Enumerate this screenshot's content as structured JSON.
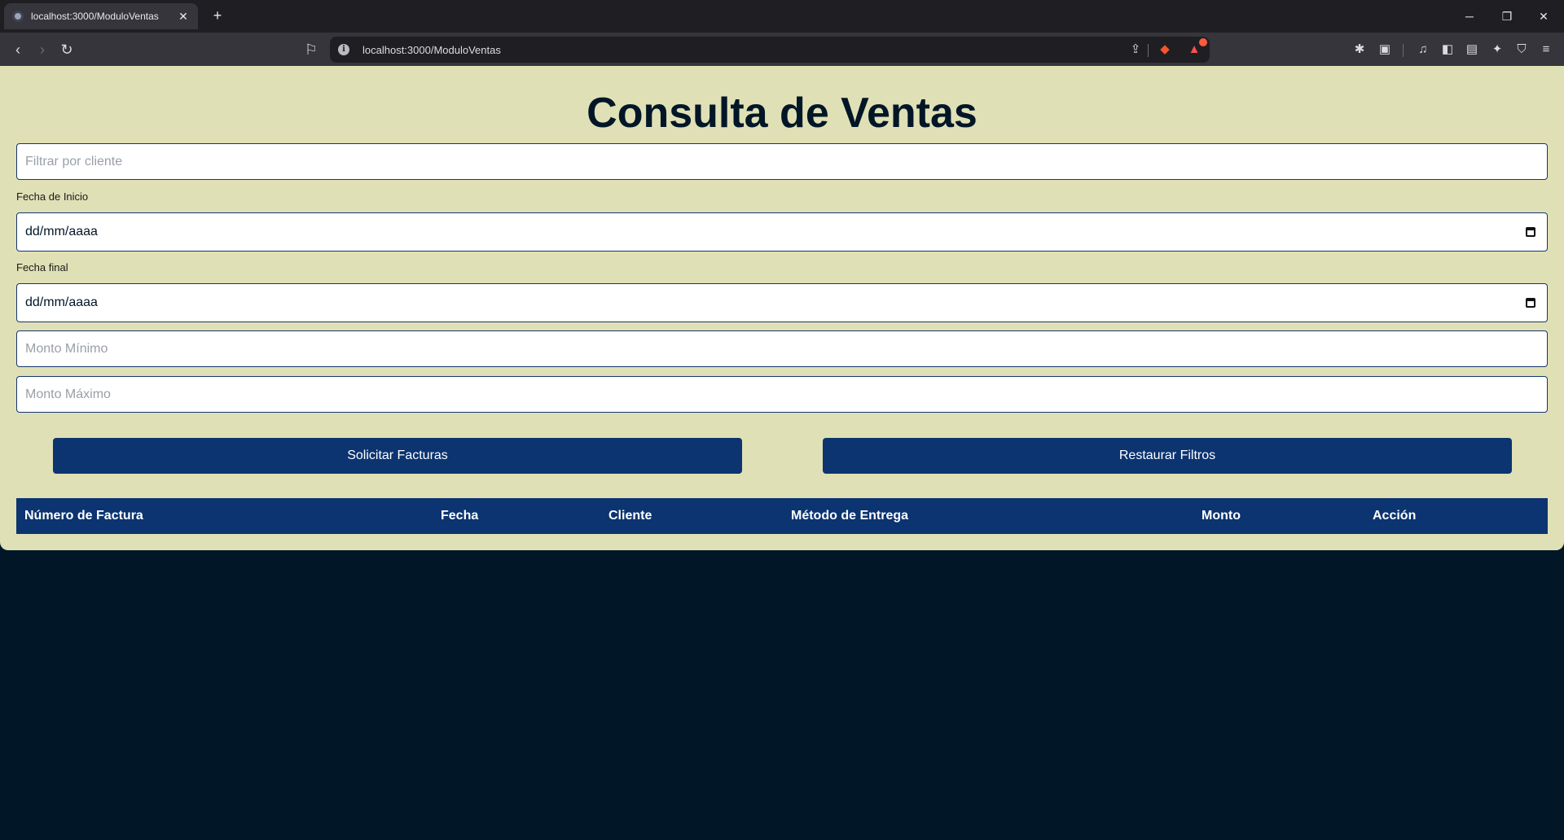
{
  "browser": {
    "tab_title": "localhost:3000/ModuloVentas",
    "tab_close": "✕",
    "new_tab": "+",
    "url": "localhost:3000/ModuloVentas",
    "window_controls": {
      "minimize": "─",
      "restore": "❐",
      "close": "✕"
    },
    "icons": [
      "back-icon",
      "forward-icon",
      "reload-icon",
      "bookmark-icon",
      "share-icon",
      "brave-shields-icon",
      "brave-rewards-icon",
      "extensions-icon",
      "tab-search-icon",
      "media-icon",
      "sidebar-icon",
      "wallet-icon",
      "leo-icon",
      "vpn-icon",
      "menu-icon"
    ]
  },
  "page": {
    "title": "Consulta de Ventas",
    "filters": {
      "client_placeholder": "Filtrar por cliente",
      "start_date_label": "Fecha de Inicio",
      "start_date_value": "dd/mm/aaaa",
      "end_date_label": "Fecha final",
      "end_date_value": "dd/mm/aaaa",
      "min_amount_placeholder": "Monto Mínimo",
      "max_amount_placeholder": "Monto Máximo"
    },
    "buttons": {
      "request": "Solicitar Facturas",
      "reset": "Restaurar Filtros"
    },
    "table": {
      "columns": [
        "Número de Factura",
        "Fecha",
        "Cliente",
        "Método de Entrega",
        "Monto",
        "Acción"
      ],
      "rows": []
    }
  },
  "colors": {
    "panel_bg": "#e0e0b6",
    "primary": "#0b3470",
    "page_bg": "#011627"
  }
}
